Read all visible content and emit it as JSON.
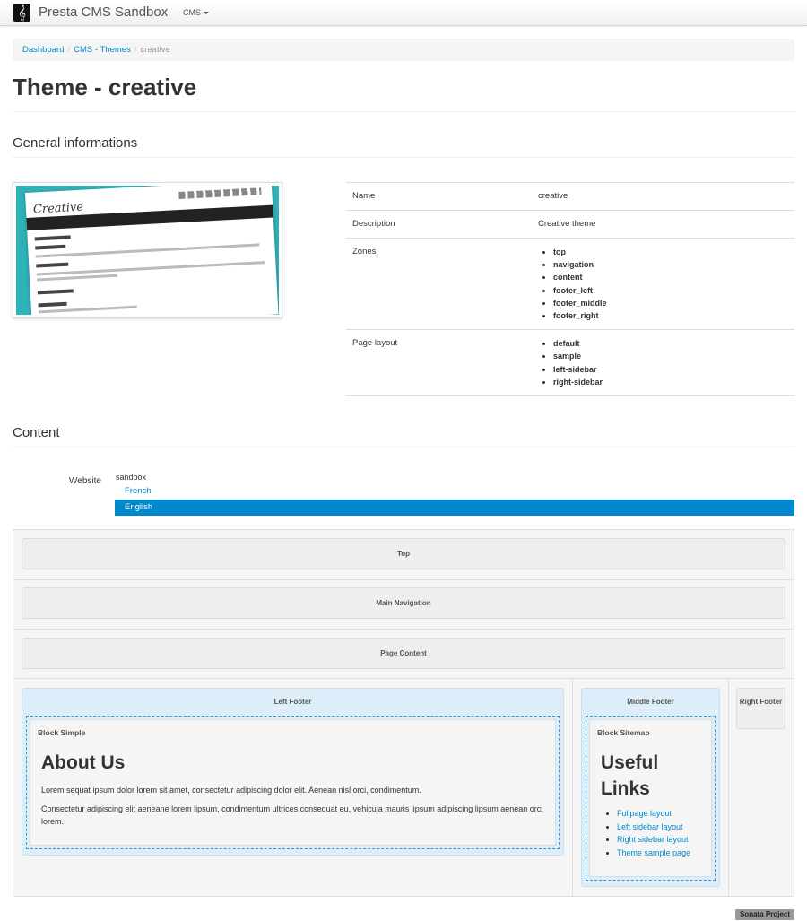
{
  "navbar": {
    "logo_glyph": "𝄞",
    "brand": "Presta CMS Sandbox",
    "menu_cms": "CMS"
  },
  "breadcrumb": {
    "items": [
      "Dashboard",
      "CMS - Themes",
      "creative"
    ]
  },
  "page_title": "Theme - creative",
  "general": {
    "heading": "General informations",
    "thumbnail_title": "Creative",
    "rows": {
      "name": {
        "label": "Name",
        "value": "creative"
      },
      "description": {
        "label": "Description",
        "value": "Creative theme"
      },
      "zones": {
        "label": "Zones",
        "items": [
          "top",
          "navigation",
          "content",
          "footer_left",
          "footer_middle",
          "footer_right"
        ]
      },
      "page_layout": {
        "label": "Page layout",
        "items": [
          "default",
          "sample",
          "left-sidebar",
          "right-sidebar"
        ]
      }
    }
  },
  "content": {
    "heading": "Content",
    "website_label": "Website",
    "website_name": "sandbox",
    "languages": [
      "French",
      "English"
    ],
    "selected_language": "English"
  },
  "layout": {
    "zones": {
      "top": "Top",
      "main_navigation": "Main Navigation",
      "page_content": "Page Content"
    },
    "left_footer": {
      "title": "Left Footer",
      "block_title": "Block Simple",
      "heading": "About Us",
      "paragraphs": [
        "Lorem sequat ipsum dolor lorem sit amet, consectetur adipiscing dolor elit. Aenean nisl orci, condimentum.",
        "Consectetur adipiscing elit aeneane lorem lipsum, condimentum ultrices consequat eu, vehicula mauris lipsum adipiscing lipsum aenean orci lorem."
      ]
    },
    "middle_footer": {
      "title": "Middle Footer",
      "block_title": "Block Sitemap",
      "heading": "Useful Links",
      "links": [
        "Fullpage layout",
        "Left sidebar layout",
        "Right sidebar layout",
        "Theme sample page"
      ]
    },
    "right_footer": {
      "title": "Right Footer"
    }
  },
  "footer_badge": "Sonata Project"
}
